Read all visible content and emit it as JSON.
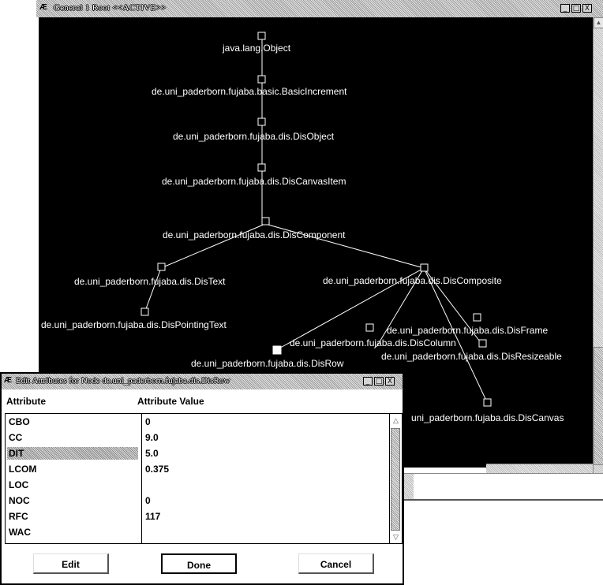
{
  "main_window": {
    "title": "General  1 Root  <<ACTIVE>>",
    "buttons": [
      "_",
      "□",
      "X"
    ]
  },
  "graph": {
    "nodes": [
      {
        "label": "java.lang.Object"
      },
      {
        "label": "de.uni_paderborn.fujaba.basic.BasicIncrement"
      },
      {
        "label": "de.uni_paderborn.fujaba.dis.DisObject"
      },
      {
        "label": "de.uni_paderborn.fujaba.dis.DisCanvasItem"
      },
      {
        "label": "de.uni_paderborn.fujaba.dis.DisComponent"
      },
      {
        "label": "de.uni_paderborn.fujaba.dis.DisText"
      },
      {
        "label": "de.uni_paderborn.fujaba.dis.DisComposite"
      },
      {
        "label": "de.uni_paderborn.fujaba.dis.DisPointingText"
      },
      {
        "label": "de.uni_paderborn.fujaba.dis.DisFrame"
      },
      {
        "label": "de.uni_paderborn.fujaba.dis.DisColumn"
      },
      {
        "label": "de.uni_paderborn.fujaba.dis.DisResizeable"
      },
      {
        "label": "de.uni_paderborn.fujaba.dis.DisRow"
      },
      {
        "label": "uni_paderborn.fujaba.dis.DisCanvas"
      }
    ]
  },
  "dialog": {
    "title": "Edit Attributes for Node de.uni_paderborn.fujaba.dis.DisRow",
    "header_attribute": "Attribute",
    "header_value": "Attribute Value",
    "rows": [
      {
        "attr": "CBO",
        "value": "0"
      },
      {
        "attr": "CC",
        "value": "9.0"
      },
      {
        "attr": "DIT",
        "value": "5.0",
        "selected": true
      },
      {
        "attr": "LCOM",
        "value": "0.375"
      },
      {
        "attr": "LOC",
        "value": ""
      },
      {
        "attr": "NOC",
        "value": "0"
      },
      {
        "attr": "RFC",
        "value": "117"
      },
      {
        "attr": "WAC",
        "value": ""
      }
    ],
    "buttons": {
      "edit": "Edit",
      "done": "Done",
      "cancel": "Cancel"
    }
  }
}
